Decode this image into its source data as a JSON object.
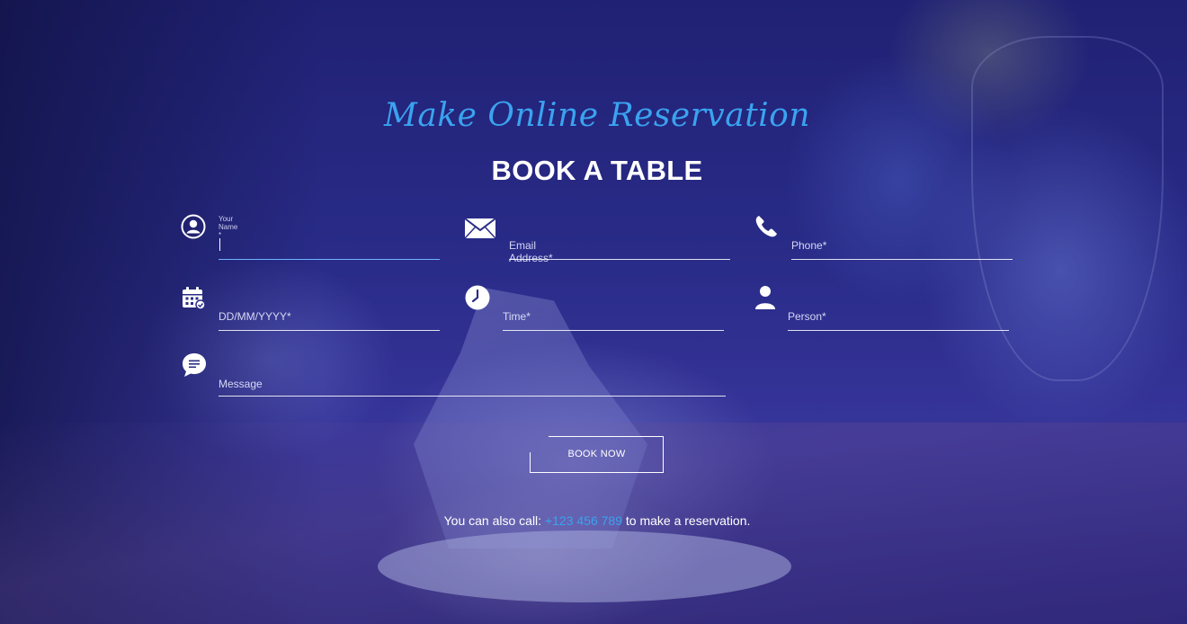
{
  "header": {
    "script_title": "Make Online Reservation",
    "title": "BOOK A TABLE"
  },
  "form": {
    "name": {
      "float_label": "Your Name *",
      "value": "",
      "icon": "user-circle-icon"
    },
    "email": {
      "placeholder": "Email Address*",
      "icon": "envelope-icon"
    },
    "phone": {
      "placeholder": "Phone*",
      "icon": "phone-icon"
    },
    "date": {
      "placeholder": "DD/MM/YYYY*",
      "icon": "calendar-icon"
    },
    "time": {
      "placeholder": "Time*",
      "icon": "clock-icon"
    },
    "person": {
      "placeholder": "Person*",
      "icon": "person-icon"
    },
    "message": {
      "placeholder": "Message",
      "icon": "chat-bubble-icon"
    },
    "submit_label": "BOOK NOW"
  },
  "footer": {
    "call_prefix": "You can also call:",
    "phone_number": "+123 456 789",
    "call_suffix": "to make a reservation."
  },
  "colors": {
    "accent": "#3aa3f0",
    "active_underline": "#6fb3ff",
    "text": "#ffffff"
  }
}
